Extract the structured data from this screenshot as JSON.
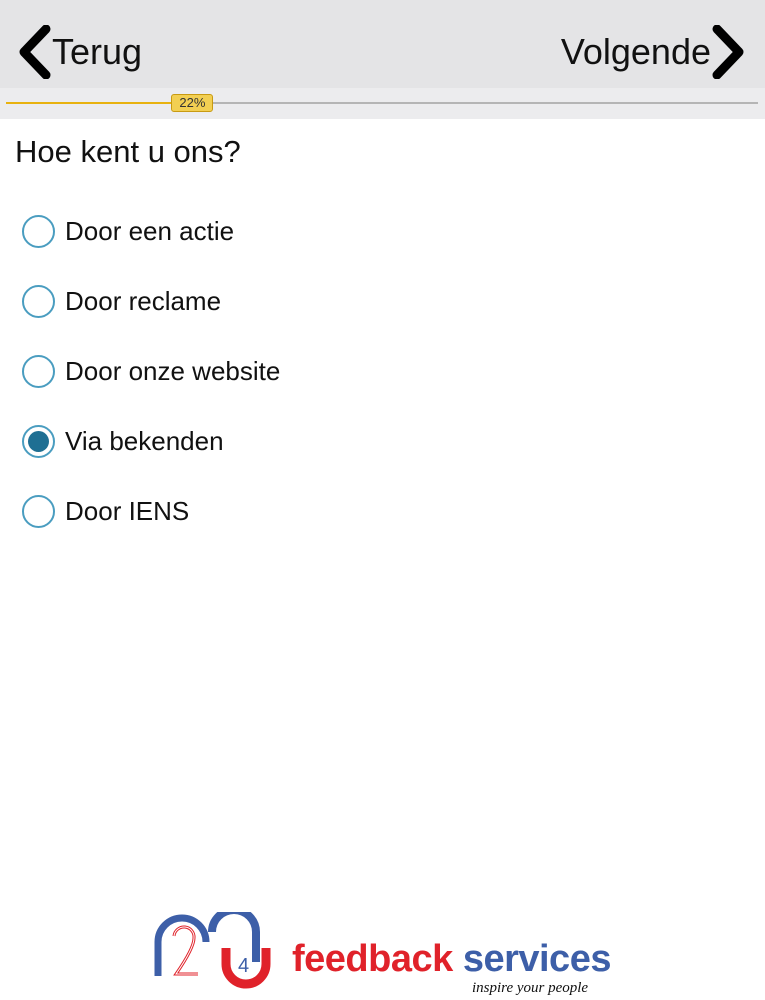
{
  "nav": {
    "back_label": "Terug",
    "next_label": "Volgende"
  },
  "progress": {
    "value_percent": 22,
    "label": "22%",
    "fill_color": "#e8b20f"
  },
  "question": {
    "title": "Hoe kent u ons?",
    "options": [
      {
        "label": "Door een actie",
        "selected": false
      },
      {
        "label": "Door reclame",
        "selected": false
      },
      {
        "label": "Door onze website",
        "selected": false
      },
      {
        "label": "Via bekenden",
        "selected": true
      },
      {
        "label": "Door IENS",
        "selected": false
      }
    ]
  },
  "footer": {
    "logo_word_1": "feedback",
    "logo_word_2": "services",
    "tagline": "inspire your people",
    "logo_mark_digit": "4"
  },
  "colors": {
    "radio_border": "#4a9dc0",
    "radio_selected": "#1f6f93",
    "brand_red": "#e0222a",
    "brand_blue": "#3d5fa8"
  }
}
